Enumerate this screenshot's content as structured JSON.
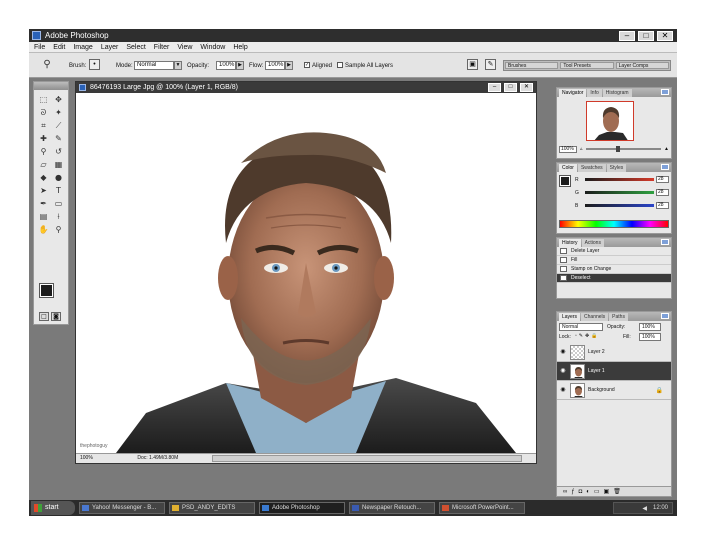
{
  "app": {
    "title": "Adobe Photoshop"
  },
  "menu": [
    "File",
    "Edit",
    "Image",
    "Layer",
    "Select",
    "Filter",
    "View",
    "Window",
    "Help"
  ],
  "window_buttons": {
    "minimize": "–",
    "maximize": "□",
    "close": "✕"
  },
  "options": {
    "mode_label": "Mode:",
    "mode_value": "Normal",
    "opacity_label": "Opacity:",
    "opacity_value": "100%",
    "flow_label": "Flow:",
    "flow_value": "100%",
    "aligned_label": "Aligned",
    "aligned_checked": true,
    "sample_label": "Sample All Layers",
    "sample_checked": false,
    "brush_label": "Brush:",
    "well_tabs": [
      "Brushes",
      "Tool Presets",
      "Layer Comps"
    ]
  },
  "document": {
    "title": "86476193 Large Jpg @ 100% (Layer 1, RGB/8)",
    "credit": "thephotoguy",
    "zoom": "100%",
    "doc_info": "Doc: 1.49M/3.80M",
    "buttons": [
      "–",
      "□",
      "✕"
    ]
  },
  "panels": {
    "navigator": {
      "tabs": [
        "Navigator",
        "Info",
        "Histogram"
      ],
      "zoom": "100%"
    },
    "color": {
      "tabs": [
        "Color",
        "Swatches",
        "Styles"
      ],
      "channels": [
        {
          "name": "R",
          "value": "28",
          "color": "#d43a2a"
        },
        {
          "name": "G",
          "value": "28",
          "color": "#2ea040"
        },
        {
          "name": "B",
          "value": "28",
          "color": "#2a44c8"
        }
      ]
    },
    "history": {
      "tabs": [
        "History",
        "Actions"
      ],
      "items": [
        "Delete Layer",
        "Fill",
        "Stamp on Change",
        "Deselect"
      ],
      "selected_index": 3
    },
    "layers": {
      "tabs": [
        "Layers",
        "Channels",
        "Paths"
      ],
      "blend_mode": "Normal",
      "opacity_label": "Opacity:",
      "opacity_value": "100%",
      "lock_label": "Lock:",
      "fill_label": "Fill:",
      "fill_value": "100%",
      "items": [
        {
          "name": "Layer 2",
          "thumb": "checker"
        },
        {
          "name": "Layer 1",
          "thumb": "face",
          "selected": true
        },
        {
          "name": "Background",
          "thumb": "face",
          "locked": true
        }
      ]
    }
  },
  "taskbar": {
    "start": "start",
    "tasks": [
      {
        "label": "Yahoo! Messenger - B...",
        "color": "#4a78d0"
      },
      {
        "label": "PSD_ANDY_EDITS",
        "color": "#e0b030"
      },
      {
        "label": "Adobe Photoshop",
        "color": "#3a7ad0",
        "active": true
      },
      {
        "label": "Newspaper Retouch...",
        "color": "#3a5ab0"
      },
      {
        "label": "Microsoft PowerPoint...",
        "color": "#d05030"
      }
    ],
    "clock": "12:00"
  },
  "colors": {
    "foreground": "#1c1c1c",
    "background": "#ffffff",
    "selection": "#3b3b3b"
  }
}
